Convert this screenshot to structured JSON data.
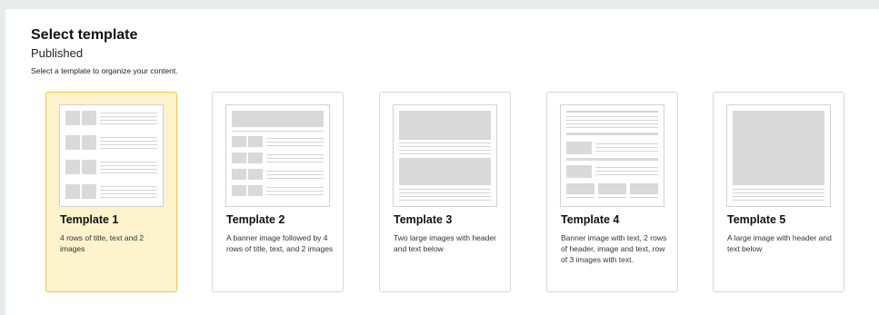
{
  "header": {
    "title": "Select template",
    "status": "Published",
    "instruction": "Select a template to organize your content."
  },
  "templates": [
    {
      "title": "Template 1",
      "description": "4 rows of title, text and 2 images",
      "selected": true
    },
    {
      "title": "Template 2",
      "description": "A banner image followed by 4 rows of title, text, and 2 images",
      "selected": false
    },
    {
      "title": "Template 3",
      "description": "Two large images with header and text below",
      "selected": false
    },
    {
      "title": "Template 4",
      "description": "Banner image with text, 2 rows of header, image and text, row of 3 images with text.",
      "selected": false
    },
    {
      "title": "Template 5",
      "description": "A large image with header and text below",
      "selected": false
    }
  ],
  "colors": {
    "selected_background": "#fcf3cd",
    "selected_border": "#f0c64a",
    "placeholder_gray": "#d9d9d9"
  }
}
